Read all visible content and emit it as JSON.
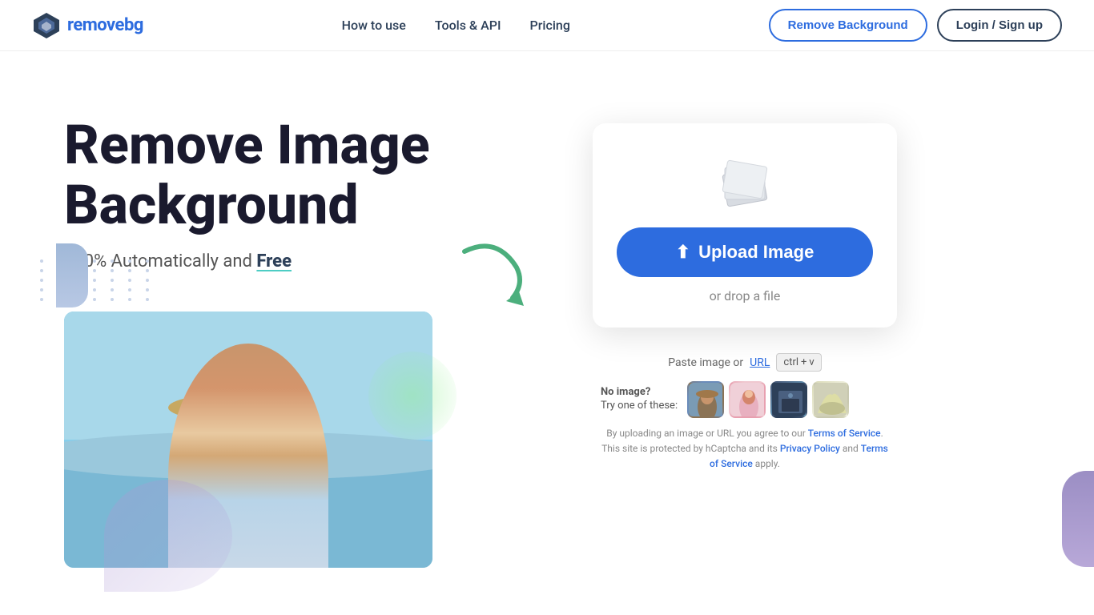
{
  "header": {
    "logo_text_remove": "remove",
    "logo_text_bg": "bg",
    "nav": [
      {
        "label": "How to use",
        "href": "#"
      },
      {
        "label": "Tools & API",
        "href": "#"
      },
      {
        "label": "Pricing",
        "href": "#"
      }
    ],
    "btn_remove_bg": "Remove Background",
    "btn_login": "Login / Sign up"
  },
  "hero": {
    "title_line1": "Remove Image",
    "title_line2": "Background",
    "subtitle_prefix": "100% Automatically and ",
    "subtitle_bold": "Free"
  },
  "upload": {
    "btn_label": "Upload Image",
    "drop_text": "or drop a file",
    "paste_text": "Paste image or",
    "paste_url_label": "URL",
    "kbd_ctrl": "ctrl",
    "kbd_plus": "+",
    "kbd_v": "v",
    "samples_label_line1": "No image?",
    "samples_label_line2": "Try one of these:",
    "legal_line1": "By uploading an image or URL you agree to our ",
    "legal_tos1": "Terms of Service",
    "legal_middle": ". This site is protected by hCaptcha and its ",
    "legal_privacy": "Privacy Policy",
    "legal_and": " and ",
    "legal_tos2": "Terms of Service",
    "legal_end": " apply."
  },
  "icons": {
    "upload": "⬆",
    "layers": "layers-icon",
    "arrow": "arrow-curved"
  },
  "colors": {
    "primary": "#2d6cdf",
    "dark": "#1a1a2e",
    "accent_green": "#4ecdc4"
  }
}
